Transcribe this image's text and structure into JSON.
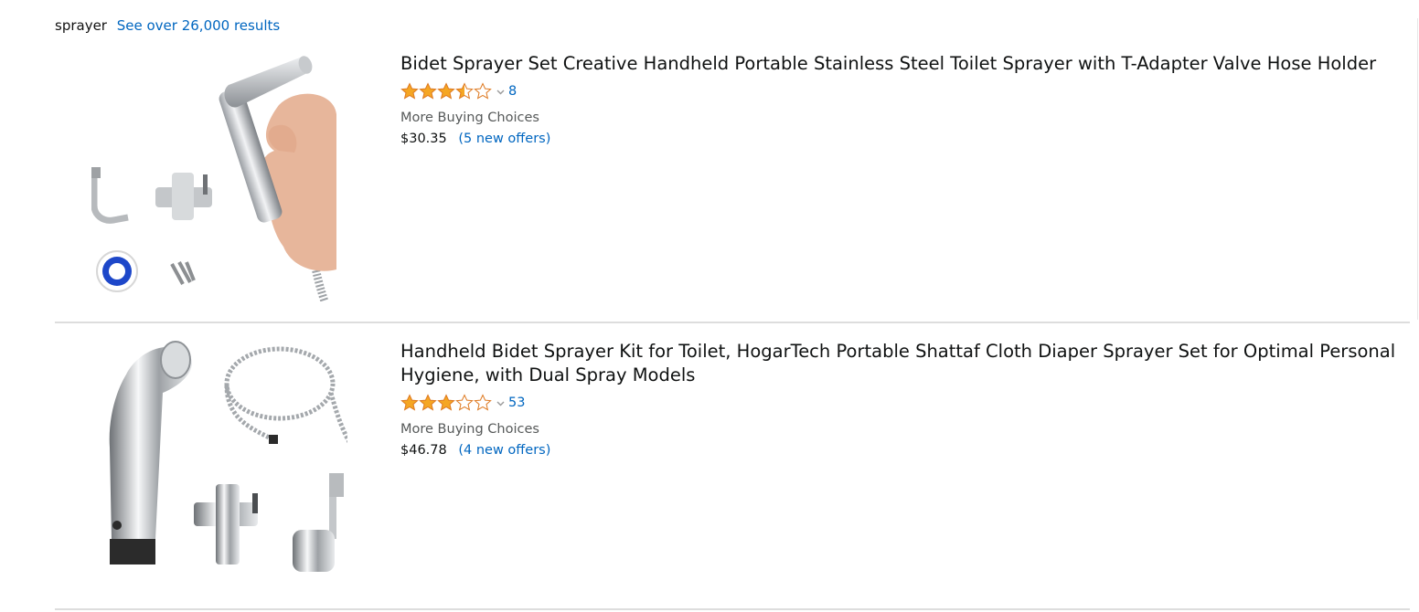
{
  "search": {
    "query": "sprayer",
    "results_link": "See over 26,000 results"
  },
  "results": [
    {
      "title": "Bidet Sprayer Set Creative Handheld Portable Stainless Steel Toilet Sprayer with T-Adapter Valve Hose Holder",
      "rating": 3.5,
      "rating_count": "8",
      "buying_choices": "More Buying Choices",
      "price": "$30.35",
      "offers": "(5 new offers)"
    },
    {
      "title": "Handheld Bidet Sprayer Kit for Toilet, HogarTech Portable Shattaf Cloth Diaper Sprayer Set for Optimal Personal Hygiene, with Dual Spray Models",
      "rating": 3.0,
      "rating_count": "53",
      "buying_choices": "More Buying Choices",
      "price": "$46.78",
      "offers": "(4 new offers)"
    }
  ],
  "colors": {
    "star": "#f5a623",
    "link": "#0066c0",
    "divider": "#dddddd"
  }
}
